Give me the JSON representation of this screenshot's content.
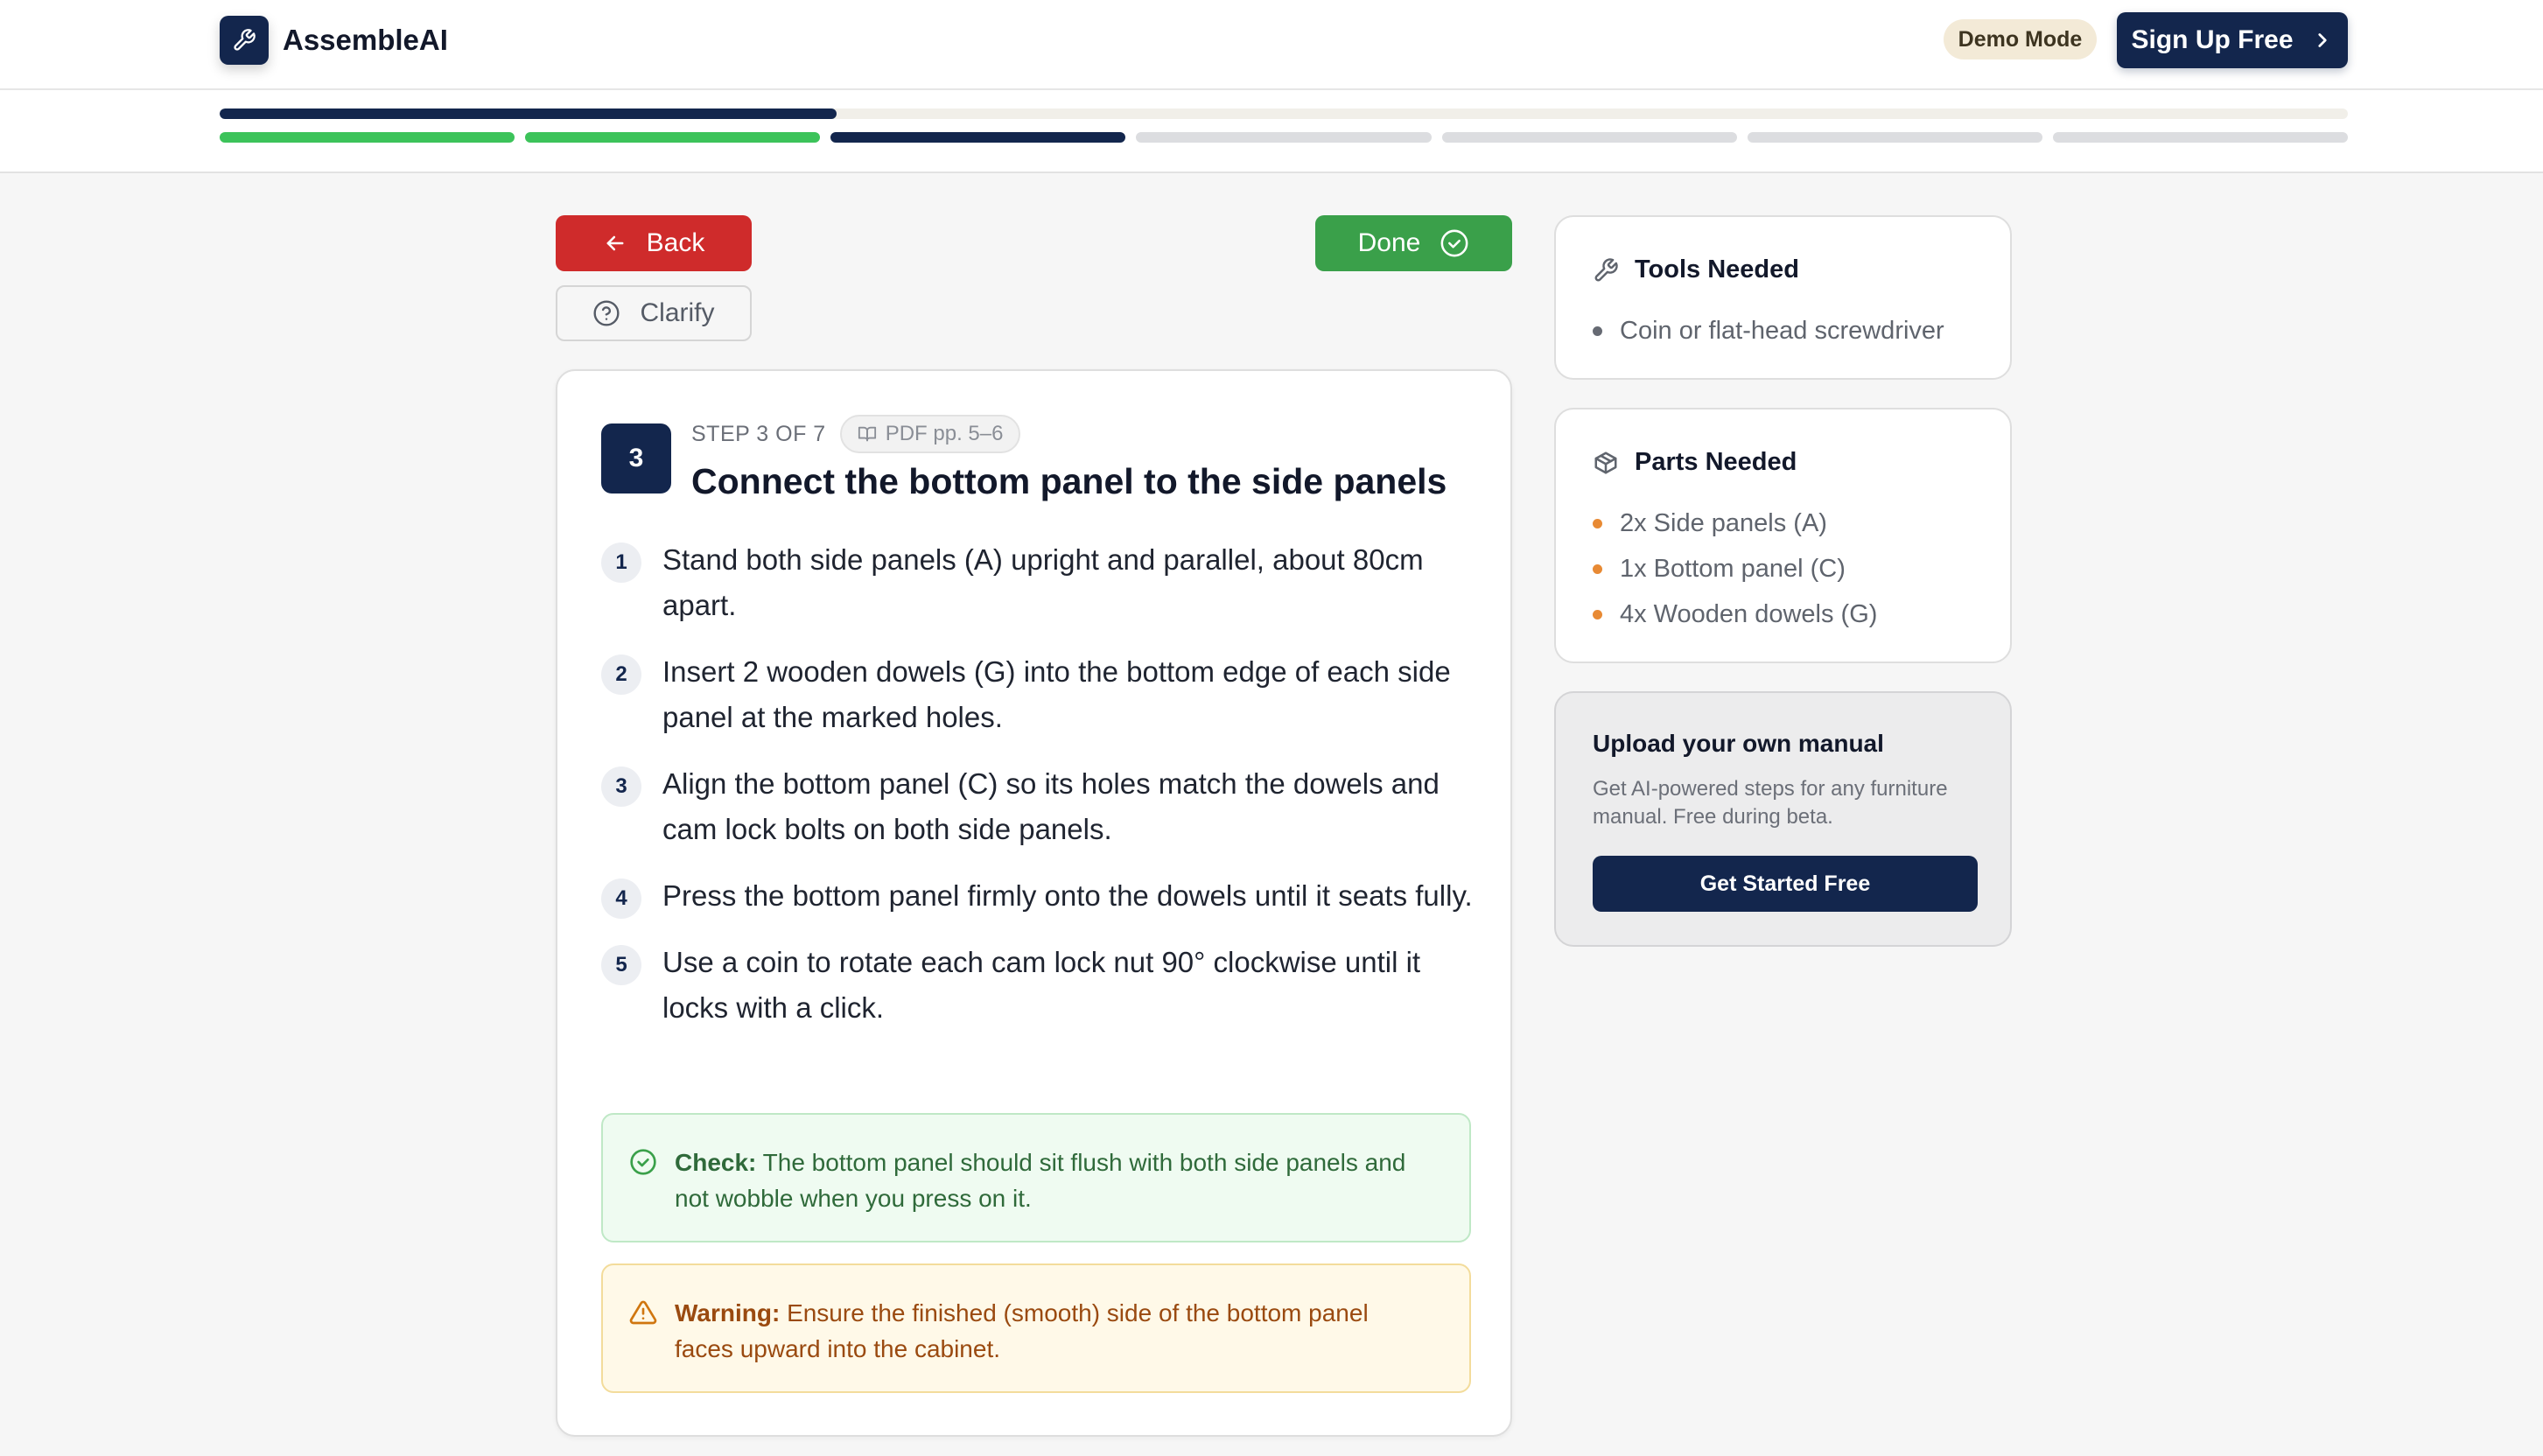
{
  "app": {
    "name": "AssembleAI",
    "demo_badge": "Demo Mode",
    "signup_label": "Sign Up Free"
  },
  "progress": {
    "overall_fraction": 0.29,
    "total_steps": 7,
    "current_step": 3,
    "completed_steps": 2
  },
  "actions": {
    "back_label": "Back",
    "clarify_label": "Clarify",
    "done_label": "Done"
  },
  "step": {
    "number": "3",
    "label": "STEP 3 OF 7",
    "pdf_ref": "PDF pp. 5–6",
    "title": "Connect the bottom panel to the side panels",
    "instructions": [
      {
        "num": "1",
        "text": "Stand both side panels (A) upright and parallel, about 80cm apart."
      },
      {
        "num": "2",
        "text": "Insert 2 wooden dowels (G) into the bottom edge of each side panel at the marked holes."
      },
      {
        "num": "3",
        "text": "Align the bottom panel (C) so its holes match the dowels and cam lock bolts on both side panels."
      },
      {
        "num": "4",
        "text": "Press the bottom panel firmly onto the dowels until it seats fully."
      },
      {
        "num": "5",
        "text": "Use a coin to rotate each cam lock nut 90° clockwise until it locks with a click."
      }
    ],
    "check": {
      "label": "Check:",
      "text": "The bottom panel should sit flush with both side panels and not wobble when you press on it."
    },
    "warning": {
      "label": "Warning:",
      "text": "Ensure the finished (smooth) side of the bottom panel faces upward into the cabinet."
    }
  },
  "tools": {
    "title": "Tools Needed",
    "items": [
      "Coin or flat-head screwdriver"
    ]
  },
  "parts": {
    "title": "Parts Needed",
    "items": [
      "2x Side panels (A)",
      "1x Bottom panel (C)",
      "4x Wooden dowels (G)"
    ]
  },
  "upload": {
    "title": "Upload your own manual",
    "description": "Get AI-powered steps for any furniture manual. Free during beta.",
    "button_label": "Get Started Free"
  },
  "colors": {
    "brand": "#13264d",
    "back": "#cf2b2b",
    "done": "#3aa04a",
    "segment_done": "#3cc35a",
    "part_bullet": "#e88a34"
  },
  "icons": {
    "logo": "wrench-icon",
    "signup": "chevron-right-icon",
    "back": "arrow-left-icon",
    "clarify": "help-circle-icon",
    "done": "check-circle-icon",
    "pdf": "book-open-icon",
    "check": "check-circle-icon",
    "warning": "alert-triangle-icon",
    "tools": "wrench-icon",
    "parts": "package-icon"
  }
}
